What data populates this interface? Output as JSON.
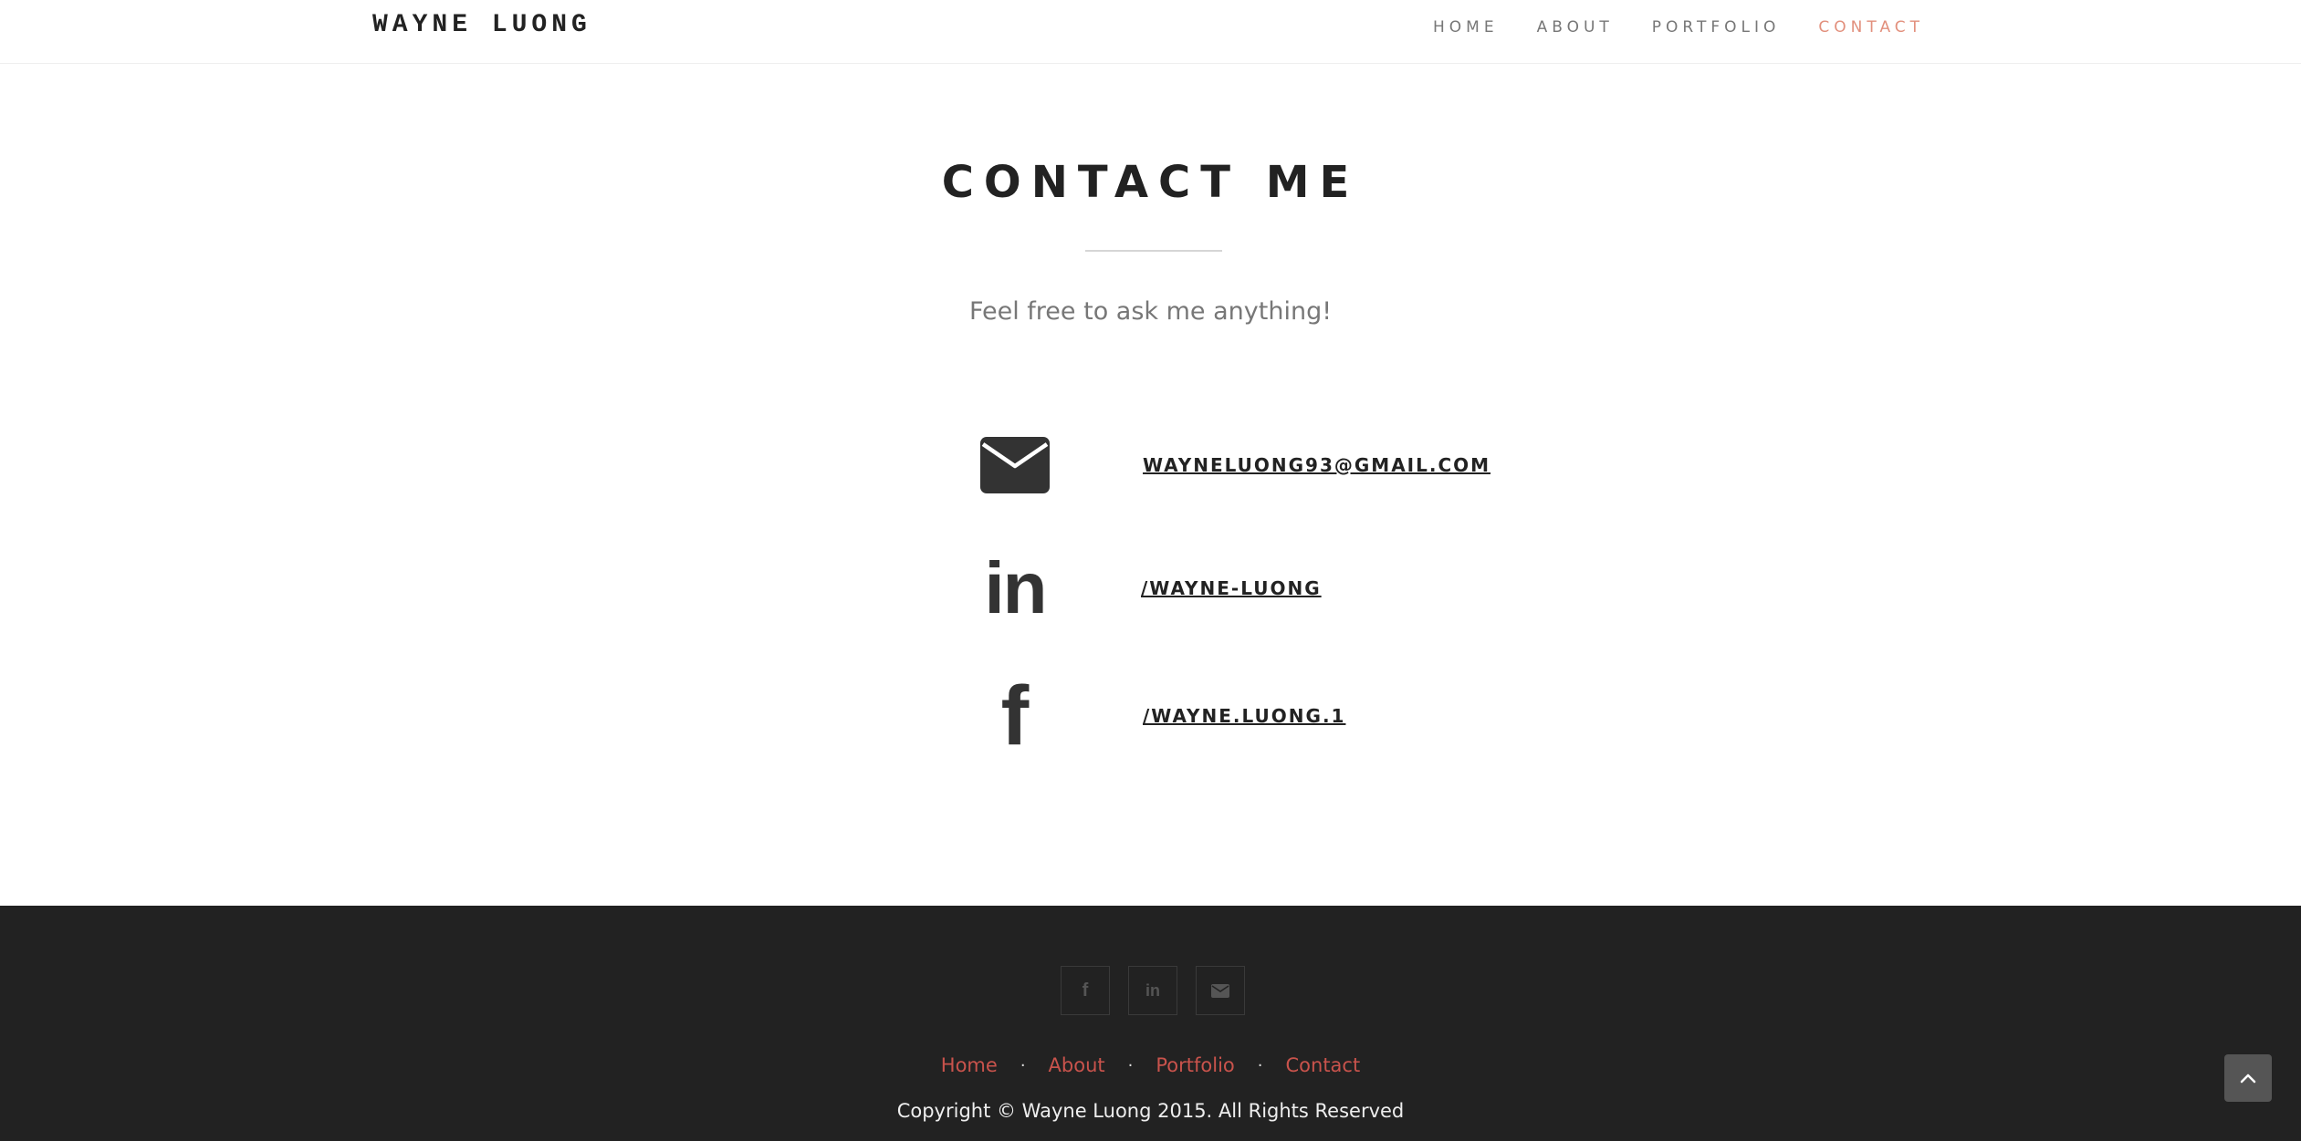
{
  "brand": "WAYNE LUONG",
  "nav": {
    "items": [
      "HOME",
      "ABOUT",
      "PORTFOLIO",
      "CONTACT"
    ],
    "active": "CONTACT",
    "active_color": "#e2907d"
  },
  "contact": {
    "title": "CONTACT ME",
    "subtitle": "Feel free to ask me anything!",
    "email": {
      "icon": "envelope-icon",
      "text": "WAYNELUONG93@GMAIL.COM"
    },
    "linkedin": {
      "icon": "linkedin-icon",
      "text": "/WAYNE-LUONG"
    },
    "facebook": {
      "icon": "facebook-icon",
      "text": "/WAYNE.LUONG.1"
    }
  },
  "footer": {
    "social_icons": [
      "facebook-icon",
      "linkedin-icon",
      "envelope-icon"
    ],
    "links": [
      "Home",
      "About",
      "Portfolio",
      "Contact"
    ],
    "link_color": "#c9534c",
    "background": "#222222",
    "copyright": "Copyright © Wayne Luong 2015. All Rights Reserved"
  },
  "scroll_top_icon": "chevron-up-icon"
}
